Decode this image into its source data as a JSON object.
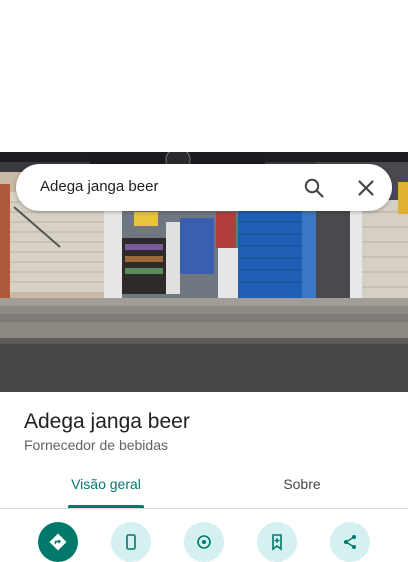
{
  "search": {
    "query": "Adega janga beer",
    "search_icon": "search-icon",
    "close_icon": "close-icon"
  },
  "place": {
    "name": "Adega janga beer",
    "category": "Fornecedor de bebidas"
  },
  "tabs": [
    {
      "label": "Visão geral",
      "active": true
    },
    {
      "label": "Sobre",
      "active": false
    }
  ],
  "actions": [
    {
      "icon": "directions-icon",
      "style": "primary"
    },
    {
      "icon": "phone-icon"
    },
    {
      "icon": "nearby-icon"
    },
    {
      "icon": "save-icon"
    },
    {
      "icon": "share-icon"
    }
  ],
  "colors": {
    "accent": "#00796b",
    "action_bg": "#d4f0f0",
    "shutter_blue": "#1f5fb5"
  }
}
